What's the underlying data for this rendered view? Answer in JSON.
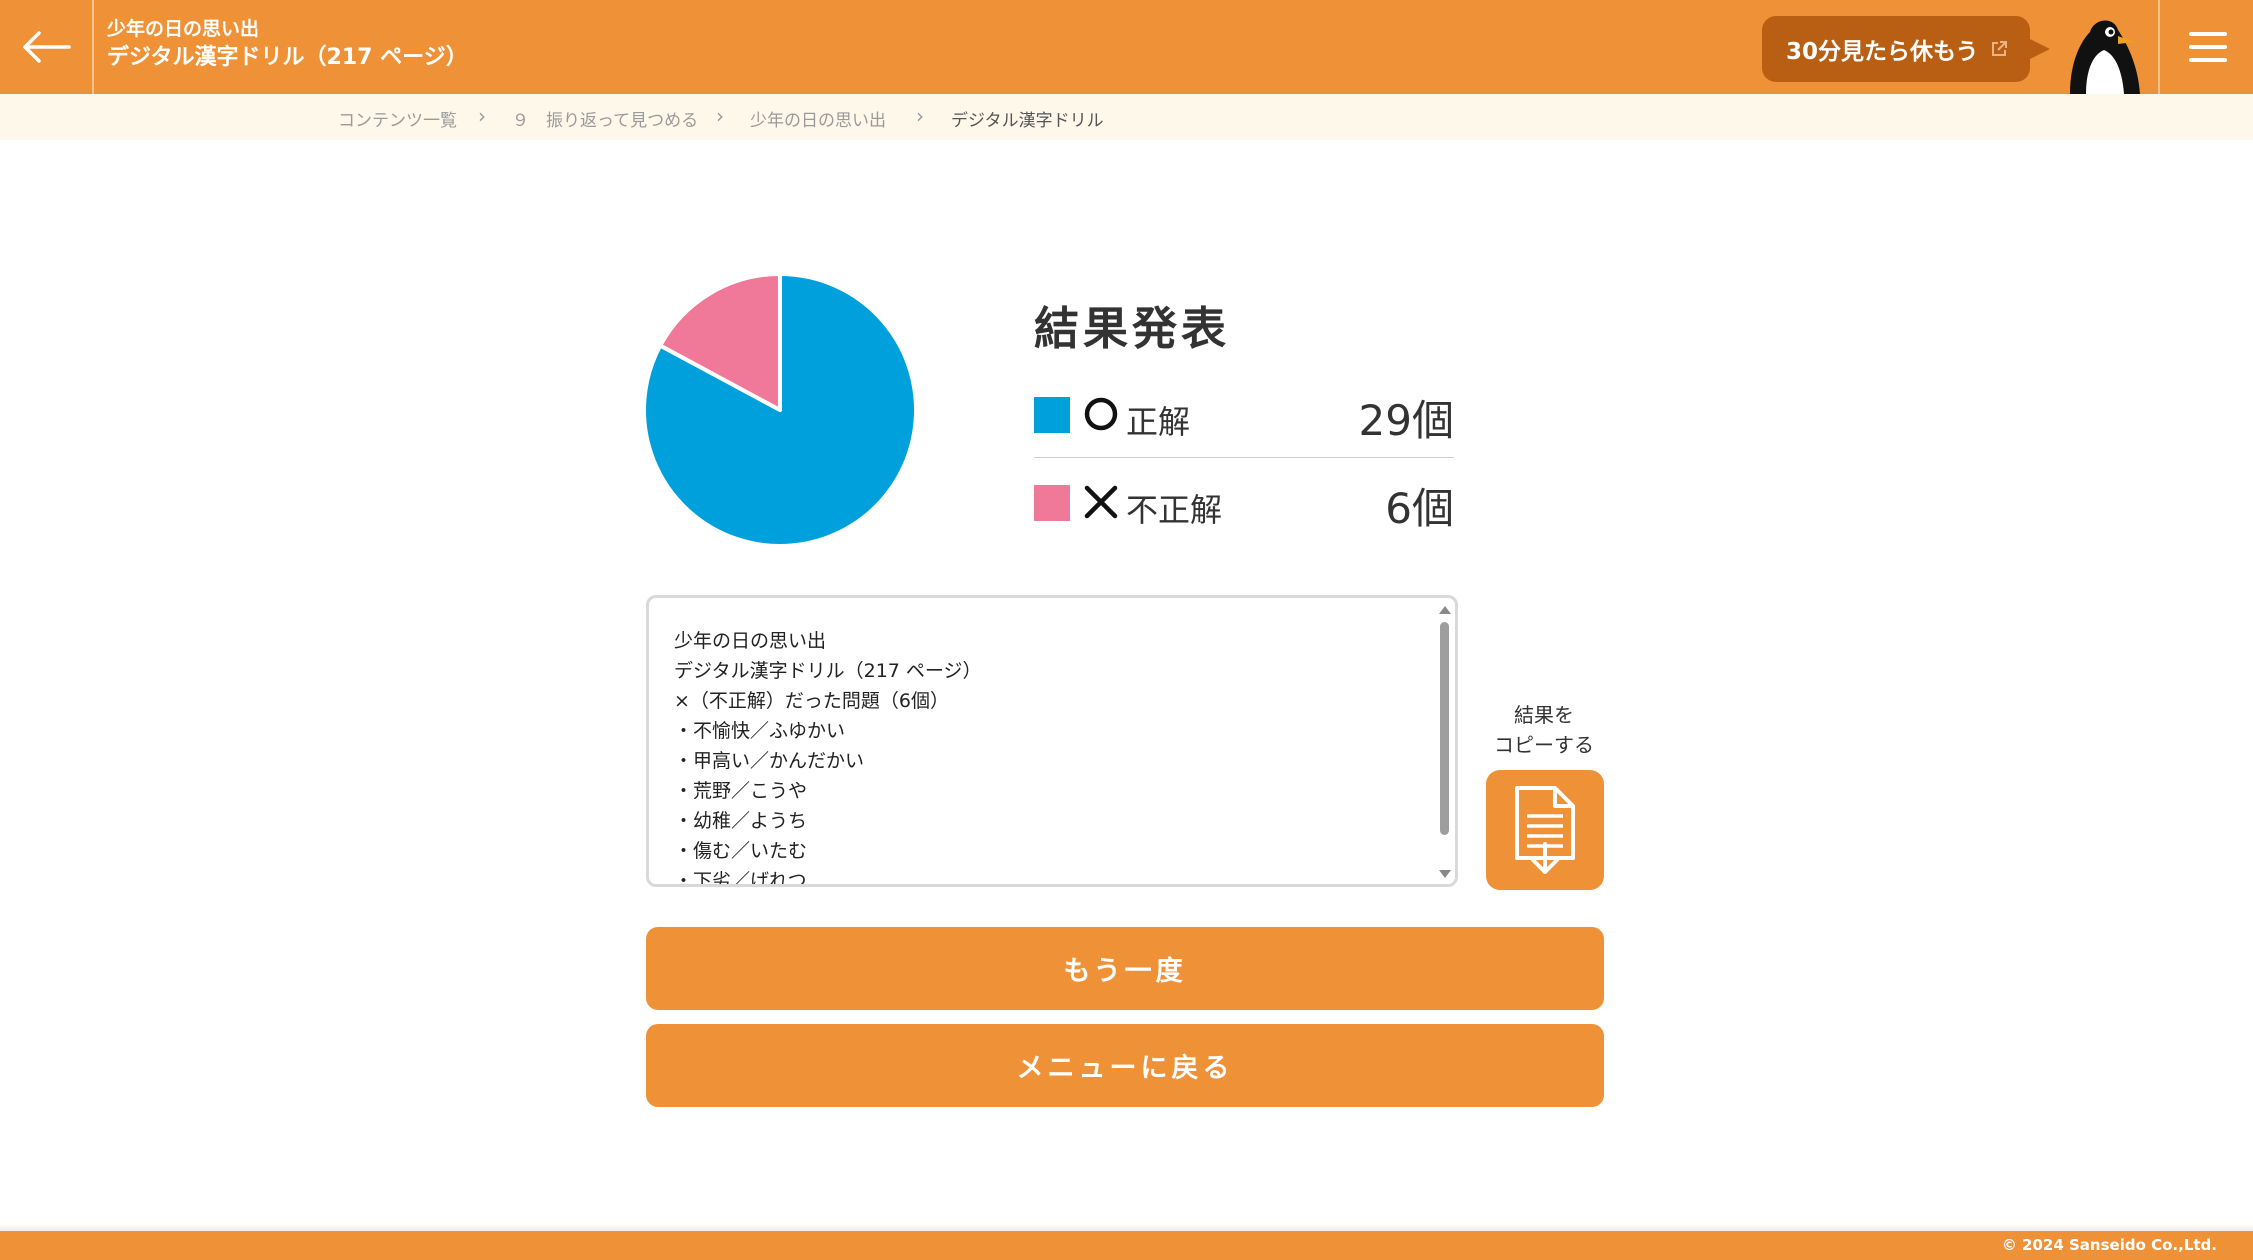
{
  "header": {
    "subtitle": "少年の日の思い出",
    "title": "デジタル漢字ドリル（217 ページ）",
    "break_button": "30分見たら休もう",
    "icons": [
      "back-arrow-icon",
      "external-link-icon",
      "penguin-icon",
      "hamburger-menu-icon"
    ]
  },
  "breadcrumb": {
    "items": [
      {
        "label": "コンテンツ一覧"
      },
      {
        "label": "９　振り返って見つめる"
      },
      {
        "label": "少年の日の思い出"
      },
      {
        "label": "デジタル漢字ドリル"
      }
    ]
  },
  "result": {
    "title": "結果発表",
    "correct": {
      "label": "正解",
      "count": "29個",
      "color": "#00a0dc"
    },
    "incorrect": {
      "label": "不正解",
      "count": "6個",
      "color": "#f07898"
    }
  },
  "chart_data": {
    "type": "pie",
    "slices": [
      {
        "label": "正解",
        "value": 29,
        "color": "#00a0dc"
      },
      {
        "label": "不正解",
        "value": 6,
        "color": "#f07898"
      }
    ]
  },
  "result_text": {
    "lines": [
      "少年の日の思い出",
      "デジタル漢字ドリル（217 ページ）",
      "×（不正解）だった問題（6個）",
      "・不愉快／ふゆかい",
      "・甲高い／かんだかい",
      "・荒野／こうや",
      "・幼稚／ようち",
      "・傷む／いたむ",
      "・下劣／げれつ"
    ]
  },
  "copy": {
    "label_line1": "結果を",
    "label_line2": "コピーする"
  },
  "buttons": {
    "retry": "もう一度",
    "back_to_menu": "メニューに戻る"
  },
  "footer": {
    "copyright": "© 2024 Sanseido Co.,Ltd."
  },
  "colors": {
    "accent": "#ef9137",
    "break_button": "#b95f13",
    "breadcrumb_bg": "#fdf8ea"
  }
}
